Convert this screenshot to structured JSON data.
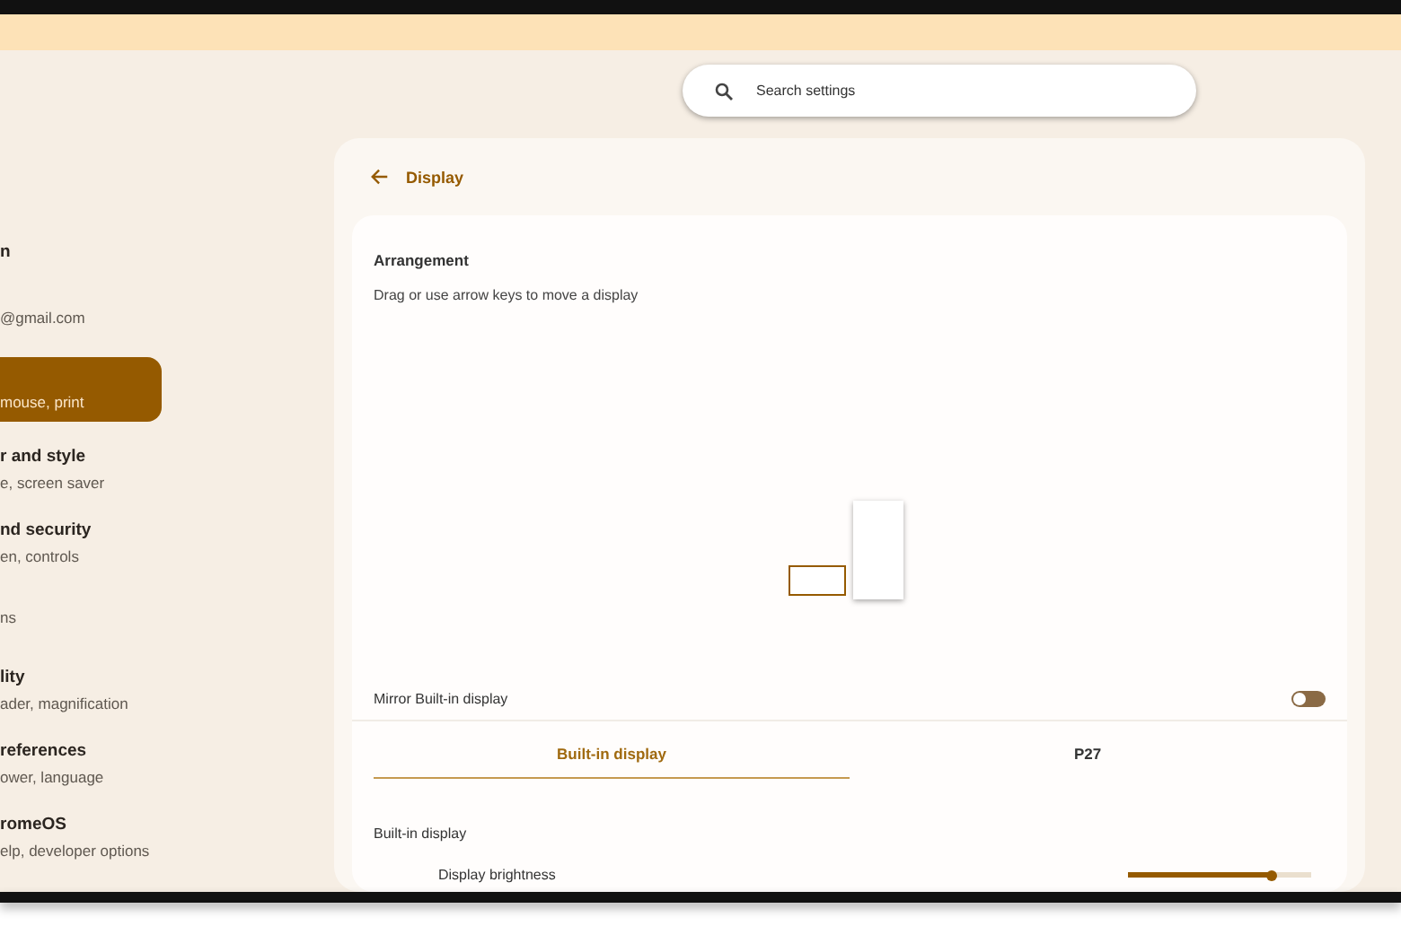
{
  "search": {
    "placeholder": "Search settings"
  },
  "sidebar": {
    "items": [
      {
        "title": "n",
        "selected": false
      },
      {
        "subtitle": "@gmail.com",
        "selected": false
      },
      {
        "subtitle": "mouse, print",
        "selected": true
      },
      {
        "title": "r and style",
        "subtitle": "e, screen saver",
        "selected": false
      },
      {
        "title": "nd security",
        "subtitle": "en, controls",
        "selected": false
      },
      {
        "subtitle": "ns",
        "selected": false
      },
      {
        "title": "lity",
        "subtitle": "ader, magnification",
        "selected": false
      },
      {
        "title": "references",
        "subtitle": "ower, language",
        "selected": false
      },
      {
        "title": "romeOS",
        "subtitle": "elp, developer options",
        "selected": false
      }
    ]
  },
  "page": {
    "title": "Display"
  },
  "arrangement": {
    "title": "Arrangement",
    "hint": "Drag or use arrow keys to move a display"
  },
  "mirror": {
    "label": "Mirror Built-in display",
    "on": false
  },
  "tabs": [
    {
      "label": "Built-in display",
      "selected": true
    },
    {
      "label": "P27",
      "selected": false
    }
  ],
  "section": {
    "title": "Built-in display",
    "brightness_label": "Display brightness",
    "level": 0.78
  }
}
